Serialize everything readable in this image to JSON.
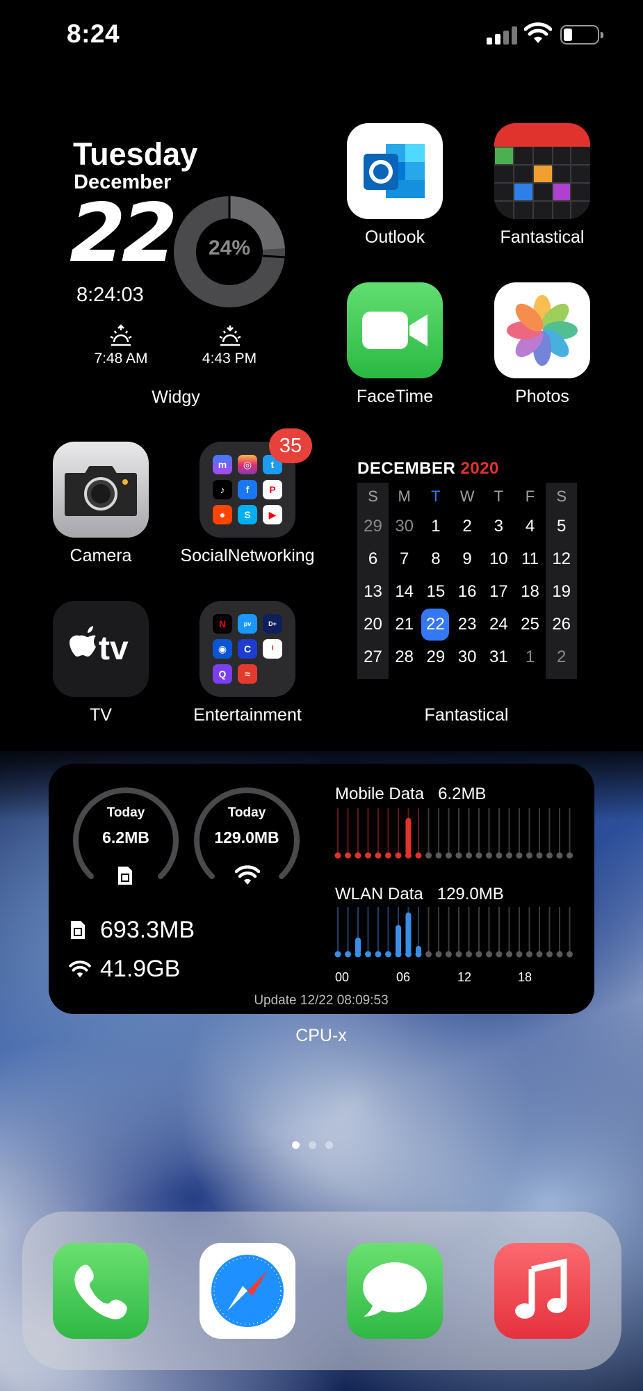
{
  "status_bar": {
    "time": "8:24"
  },
  "widgy": {
    "day": "Tuesday",
    "month": "December",
    "date": "22",
    "clock": "8:24:03",
    "battery_percent": "24%",
    "sunrise": "7:48 AM",
    "sunset": "4:43 PM",
    "label": "Widgy"
  },
  "apps": {
    "outlook": "Outlook",
    "fantastical": "Fantastical",
    "facetime": "FaceTime",
    "photos": "Photos",
    "camera": "Camera",
    "social": "SocialNetworking",
    "social_badge": "35",
    "tv": "TV",
    "entertainment": "Entertainment"
  },
  "calendar": {
    "month": "DECEMBER",
    "year": "2020",
    "weekdays": [
      "S",
      "M",
      "T",
      "W",
      "T",
      "F",
      "S"
    ],
    "weeks": [
      [
        "29",
        "30",
        "1",
        "2",
        "3",
        "4",
        "5"
      ],
      [
        "6",
        "7",
        "8",
        "9",
        "10",
        "11",
        "12"
      ],
      [
        "13",
        "14",
        "15",
        "16",
        "17",
        "18",
        "19"
      ],
      [
        "20",
        "21",
        "22",
        "23",
        "24",
        "25",
        "26"
      ],
      [
        "27",
        "28",
        "29",
        "30",
        "31",
        "1",
        "2"
      ]
    ],
    "today": "22",
    "label": "Fantastical",
    "accent": "#3478f6",
    "year_color": "#e0332d"
  },
  "cpux": {
    "mobile_today_label": "Today",
    "mobile_today": "6.2MB",
    "wlan_today_label": "Today",
    "wlan_today": "129.0MB",
    "mobile_total": "693.3MB",
    "wlan_total": "41.9GB",
    "mobile_title": "Mobile Data",
    "mobile_value": "6.2MB",
    "wlan_title": "WLAN Data",
    "wlan_value": "129.0MB",
    "hour_labels": [
      "00",
      "06",
      "12",
      "18"
    ],
    "mobile_hourly": [
      0.1,
      0.1,
      0.1,
      0.1,
      0.1,
      0.1,
      0.1,
      0.9,
      0.1,
      0,
      0,
      0,
      0,
      0,
      0,
      0,
      0,
      0,
      0,
      0,
      0,
      0,
      0,
      0
    ],
    "wlan_hourly": [
      0.1,
      0.1,
      0.4,
      0.1,
      0.1,
      0.1,
      0.7,
      1.0,
      0.2,
      0,
      0,
      0,
      0,
      0,
      0,
      0,
      0,
      0,
      0,
      0,
      0,
      0,
      0,
      0
    ],
    "mobile_color": "#e0332d",
    "wlan_color": "#3a8ee6",
    "update": "Update 12/22 08:09:53",
    "label": "CPU-x"
  },
  "dock": [
    "phone-icon",
    "safari-icon",
    "messages-icon",
    "music-icon"
  ]
}
